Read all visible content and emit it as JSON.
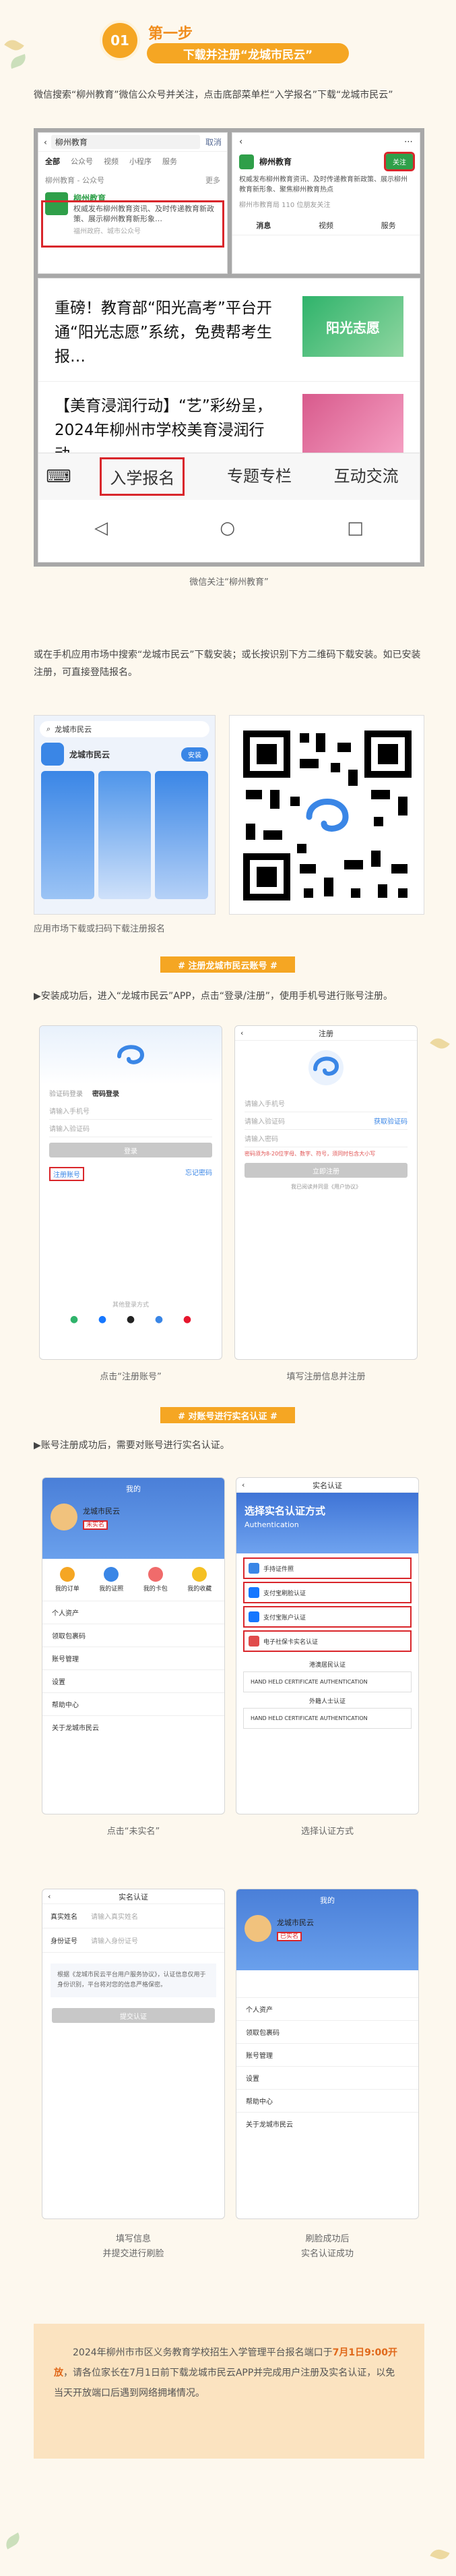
{
  "step": {
    "number": "01",
    "label": "第一步",
    "title": "下载并注册“龙城市民云”"
  },
  "intro_text": "微信搜索“柳州教育”微信公众号并关注，点击底部菜单栏“入学报名”下载“龙城市民云”",
  "wechat_shot": {
    "search_query": "柳州教育",
    "cancel": "取消",
    "tabs": [
      "全部",
      "公众号",
      "视频",
      "小程序",
      "服务"
    ],
    "section": "柳州教育 - 公众号",
    "more": "更多",
    "account_name": "柳州教育",
    "account_desc": "权威发布柳州教育资讯、及时传递教育新政策、展示柳州教育新形象…",
    "account_meta": "福州政府、城市公众号",
    "profile_name": "柳州教育",
    "follow": "关注",
    "profile_desc": "权威发布柳州教育资讯、及时传递教育新政策、展示柳州教育新形象、聚焦柳州教育热点",
    "profile_meta": "柳州市教育局 110 位朋友关注",
    "profile_tabs": [
      "消息",
      "视频",
      "服务"
    ],
    "article1": "重磅！教育部“阳光高考”平台开通“阳光志愿”系统，免费帮考生报…",
    "article1_thumb": "阳光志愿",
    "article2": "【美育浸润行动】“艺”彩纷呈，2024年柳州市学校美育浸润行动…",
    "menu": [
      "入学报名",
      "专题专栏",
      "互动交流"
    ]
  },
  "caption1": "微信关注“柳州教育”",
  "para2": "或在手机应用市场中搜索“龙城市民云”下载安装；或长按识别下方二维码下载安装。如已安装注册，可直接登陆报名。",
  "appstore": {
    "search": "龙城市民云",
    "app_name": "龙城市民云",
    "install": "安装"
  },
  "caption2": "应用市场下载或扫码下载注册报名",
  "tag_register": "# 注册龙城市民云账号 #",
  "para3": "▶安装成功后，进入“龙城市民云”APP，点击“登录/注册”，使用手机号进行账号注册。",
  "login_phone": {
    "tabs": [
      "验证码登录",
      "密码登录"
    ],
    "phone_placeholder": "请输入手机号",
    "code_placeholder": "请输入验证码",
    "login_btn": "登录",
    "register": "注册账号",
    "forgot": "忘记密码",
    "other": "其他登录方式"
  },
  "register_phone": {
    "title": "注册",
    "phone_placeholder": "请输入手机号",
    "code_placeholder": "请输入验证码",
    "get_code": "获取验证码",
    "password_placeholder": "请输入密码",
    "hint": "密码须为8-20位字母、数字、符号，须同时包含大小写",
    "confirm": "立即注册",
    "agree": "我已阅读并同意《用户协议》"
  },
  "caption3a": "点击“注册账号”",
  "caption3b": "填写注册信息并注册",
  "tag_verify": "# 对账号进行实名认证 #",
  "para4": "▶账号注册成功后，需要对账号进行实名认证。",
  "mine_phone": {
    "title": "我的",
    "user": "龙城市民云",
    "unverified": "未实名",
    "icons": [
      "我的订单",
      "我的证照",
      "我的卡包",
      "我的收藏"
    ],
    "list": [
      "个人资产",
      "领取包裹码",
      "账号管理",
      "设置",
      "帮助中心",
      "关于龙城市民云"
    ]
  },
  "verify_phone": {
    "title": "实名认证",
    "banner_title": "选择实名认证方式",
    "banner_sub": "Authentication",
    "options": [
      "手持证件照",
      "支付宝刷脸认证",
      "支付宝账户认证",
      "电子社保卡实名认证"
    ],
    "hk_section": "港澳居民认证",
    "hk_card": "HAND HELD CERTIFICATE AUTHENTICATION",
    "fo_section": "外籍人士认证",
    "fo_card": "HAND HELD CERTIFICATE AUTHENTICATION"
  },
  "caption4a": "点击“未实名”",
  "caption4b": "选择认证方式",
  "form_phone": {
    "title": "实名认证",
    "name_label": "真实姓名",
    "name_placeholder": "请输入真实姓名",
    "id_label": "身份证号",
    "id_placeholder": "请输入身份证号",
    "notice": "根据《龙城市民云平台用户服务协议》，认证信息仅用于身份识别，平台将对您的信息严格保密。",
    "submit": "提交认证"
  },
  "done_phone": {
    "title": "我的",
    "user": "龙城市民云",
    "verified": "已实名",
    "list": [
      "个人资产",
      "领取包裹码",
      "账号管理",
      "设置",
      "帮助中心",
      "关于龙城市民云"
    ]
  },
  "caption5a": "填写信息",
  "caption5b": "并提交进行刷脸",
  "caption5c": "刷脸成功后",
  "caption5d": "实名认证成功",
  "notice": {
    "part1": "2024年柳州市市区义务教育学校招生入学管理平台报名端口于",
    "highlight": "7月1日9:00开放",
    "part2": "，请各位家长在7月1日前下载龙城市民云APP并完成用户注册及实名认证，以免当天开放端口后遇到网络拥堵情况。"
  }
}
